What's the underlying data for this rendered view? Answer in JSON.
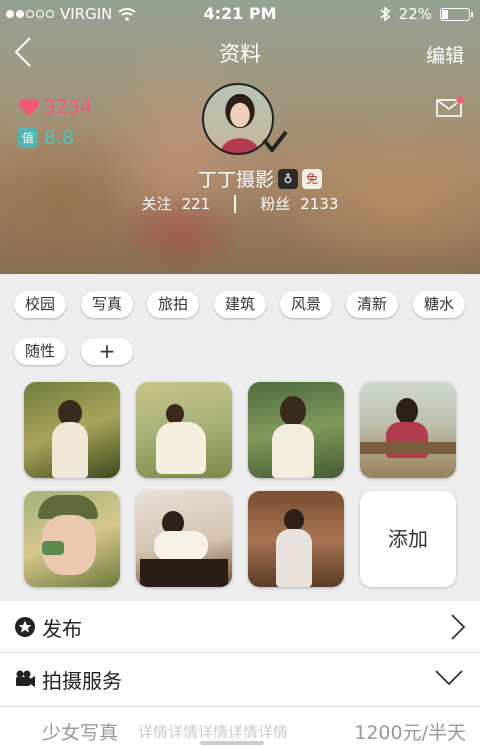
{
  "status_bar": {
    "carrier": "VIRGIN",
    "time": "4:21 PM",
    "battery": "22%",
    "signal_bars": 2,
    "battery_level": 0.22
  },
  "nav": {
    "title": "资料",
    "edit": "编辑"
  },
  "profile": {
    "likes": "3234",
    "score_label": "值",
    "score": "8.8",
    "name": "丁丁摄影",
    "gender_badge": "♁",
    "free_badge": "免",
    "following_label": "关注",
    "following": "221",
    "fans_label": "粉丝",
    "fans": "2133"
  },
  "tags": [
    "校园",
    "写真",
    "旅拍",
    "建筑",
    "风景",
    "清新",
    "糖水",
    "随性"
  ],
  "add_tag": "+",
  "add_photo": "添加",
  "menu": {
    "publish": "发布",
    "service": "拍摄服务"
  },
  "service_item": {
    "name": "少女写真",
    "detail": "详情详情详情详情详情",
    "price": "1200元/半天"
  },
  "colors": {
    "likes": "#f25a73",
    "score": "#4fc3c0",
    "background": "#ededed"
  }
}
